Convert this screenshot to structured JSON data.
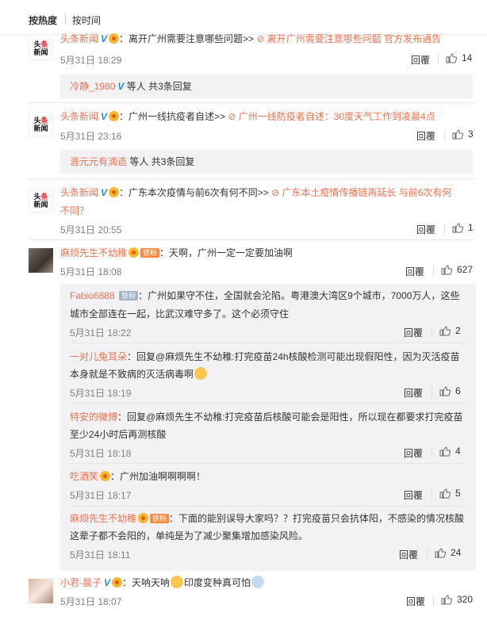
{
  "sort": {
    "hot": "按热度",
    "time": "按时间"
  },
  "reply_label": "回覆",
  "comments": [
    {
      "author": "头条新闻",
      "text": "：离开广州需要注意哪些问题>>",
      "link": "离开广州需要注意哪些问题 官方发布通告",
      "time": "5月31日 18:29",
      "likes": "14",
      "sub": {
        "user": "冷静_1980",
        "rest": "等人 共3条回复"
      }
    },
    {
      "author": "头条新闻",
      "text": "：广州一线抗疫者自述>>",
      "link": "广州一线防疫者自述：30度天气工作到凌晨4点",
      "time": "5月31日 23:16",
      "likes": "3",
      "sub": {
        "user": "涯元元有滴造",
        "rest": "等人 共3条回复"
      }
    },
    {
      "author": "头条新闻",
      "text": "：广东本次疫情与前6次有何不同>>",
      "link": "广东本土疫情传播链再延长 与前6次有何",
      "link2": "不同？",
      "time": "5月31日 20:55",
      "likes": "1"
    },
    {
      "author": "麻烦先生不幼稚",
      "badge": "铁粉",
      "text": "：天啊，广州一定一定要加油啊",
      "time": "5月31日 18:08",
      "likes": "627"
    }
  ],
  "replies": [
    {
      "author": "Fabio6888",
      "badge": "铁粉",
      "line1": "：广州如果守不住，全国就会沦陷。粤港澳大湾区9个城市，7000万人，这些",
      "line2": "城市全部连在一起，比武汉难守多了。这个必须守住",
      "time": "5月31日 18:22",
      "likes": "2"
    },
    {
      "author": "一对儿兔耳朵",
      "line1": "：回复@麻烦先生不幼稚:打完疫苗24h核酸检测可能出现假阳性，因为灭活疫苗",
      "line2": "本身就是不致病的灭活病毒啊",
      "time": "5月31日 18:19",
      "likes": "6"
    },
    {
      "author": "特安的微博",
      "line1": "：回复@麻烦先生不幼稚:打完疫苗后核酸可能会是阳性，所以现在都要求打完疫苗",
      "line2": "至少24小时后再测核酸",
      "time": "5月31日 18:18",
      "likes": "4"
    },
    {
      "author": "吃酒笑",
      "line1": "：广州加油啊啊啊啊！",
      "time": "5月31日 18:17",
      "likes": "5"
    },
    {
      "author": "麻烦先生不幼稚",
      "badge": "铁粉",
      "line1": "：下面的能别误导大家吗？？打完疫苗只会抗体阳，不感染的情况核酸",
      "line2": "这辈子都不会阳的，单纯是为了减少聚集增加感染风险。",
      "time": "5月31日 18:11",
      "likes": "24"
    }
  ],
  "last": {
    "author": "小君-晨子",
    "text1": "：天呐天呐",
    "text2": "印度变种真可怕",
    "time": "5月31日 18:07",
    "likes": "320"
  }
}
